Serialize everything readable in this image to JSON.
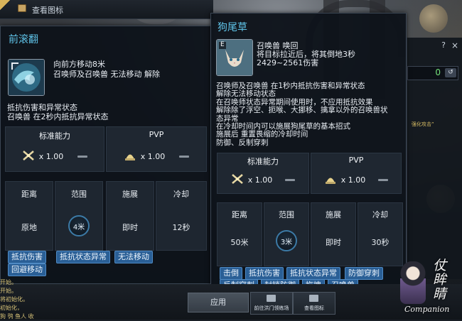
{
  "window": {
    "title": "查看图标",
    "colors": {
      "accent_title": "#5fc3e8",
      "tag_bg": "#2a5f96",
      "panel_bg": "#0e131a"
    }
  },
  "left_panel": {
    "title": "前滚翻",
    "icon": "swirl-water-skill-icon",
    "desc_lines": [
      "向前方移动8米",
      "召唤师及召唤兽 无法移动 解除"
    ],
    "effect_lines": [
      "抵抗伤害和异常状态",
      "召唤兽 在2秒内抵抗异常状态"
    ],
    "stats": {
      "standard_label": "标准能力",
      "pvp_label": "PVP",
      "standard_value": "x 1.00",
      "pvp_value": "x 1.00",
      "standard_icon": "crossed-swords-icon",
      "pvp_icon": "pvp-helmet-icon"
    },
    "tiles": [
      {
        "label": "距离",
        "value": "原地"
      },
      {
        "label": "范围",
        "value": "4米"
      },
      {
        "label": "施展",
        "value": "即时"
      },
      {
        "label": "冷却",
        "value": "12秒"
      }
    ],
    "tags": [
      "抵抗伤害",
      "抵抗状态异常",
      "无法移动",
      "回避移动"
    ]
  },
  "right_panel": {
    "title": "狗尾草",
    "icon": "cat-summon-skill-icon",
    "icon_key": "E",
    "desc_lines": [
      "召唤兽 唤回",
      "将目标拉近后，将其倒地3秒",
      "2429~2561伤害"
    ],
    "effect_lines": [
      "召唤师及召唤兽 在1秒内抵抗伤害和异常状态",
      "解除无法移动状态",
      "在召唤师状态异常期间使用时，不应用抵抗效果",
      "解除除了浮空、扼喉、大挪移、擒拿以外的召唤兽状",
      "态异常",
      "在冷却时间内可以施展狗尾草的基本招式",
      "施展后 重置畏缩的冷却时间",
      "防御、反制穿刺"
    ],
    "stats": {
      "standard_label": "标准能力",
      "pvp_label": "PVP",
      "standard_value": "x 1.00",
      "pvp_value": "x 1.00",
      "standard_icon": "crossed-swords-icon",
      "pvp_icon": "pvp-helmet-icon"
    },
    "tiles": [
      {
        "label": "距离",
        "value": "50米"
      },
      {
        "label": "范围",
        "value": "3米"
      },
      {
        "label": "施展",
        "value": "即时"
      },
      {
        "label": "冷却",
        "value": "30秒"
      }
    ],
    "tags": [
      "击倒",
      "抵抗伤害",
      "抵抗状态异常",
      "防御穿刺",
      "反制穿刺",
      "封锁防御",
      "拖拽",
      "召唤兽"
    ]
  },
  "side_window": {
    "help": "?",
    "close": "×",
    "counter_value": "0",
    "reset_icon": "reset-icon",
    "note": "强化攻击”"
  },
  "bottom": {
    "chat_lines": [
      "开始。",
      "开始。",
      "将初始化。",
      "初始化，",
      "狗 鸮  鱼人 收"
    ],
    "apply_label": "应用",
    "nav_buttons": [
      {
        "label": "前往洪门领练场",
        "icon": "dojo-icon"
      },
      {
        "label": "查看图标",
        "icon": "view-icon-icon"
      }
    ]
  },
  "watermark": {
    "script_text": "仗 眸 睛",
    "caption": "Companion"
  }
}
